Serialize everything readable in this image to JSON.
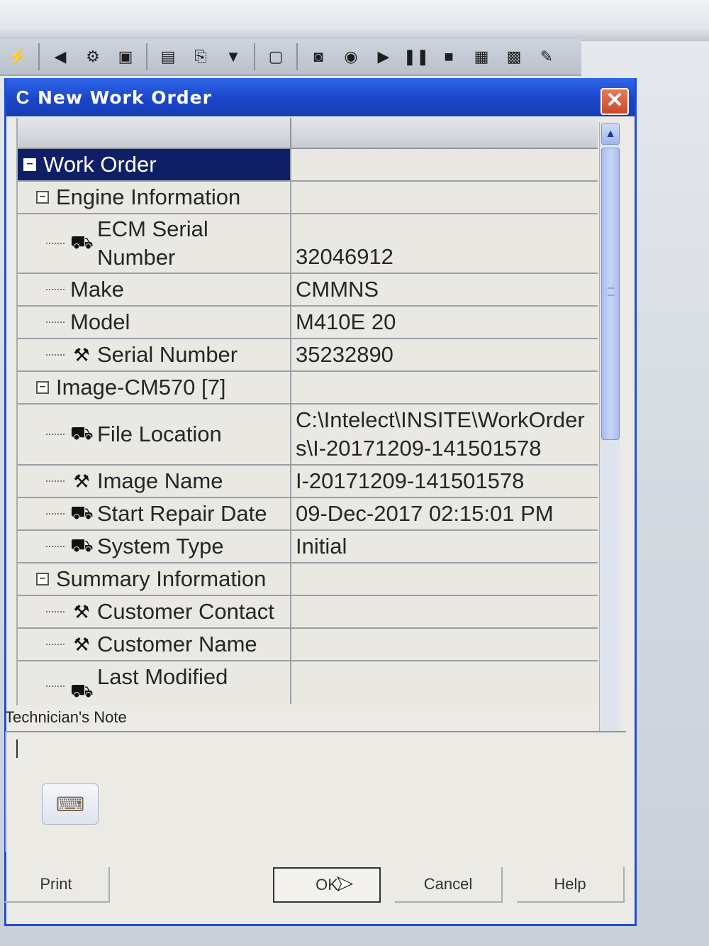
{
  "window": {
    "title": "New Work Order",
    "close_label": "✕"
  },
  "toolbar": {
    "icons": [
      "connect-icon",
      "back-icon",
      "tools-icon",
      "print-icon",
      "document-icon",
      "export-icon",
      "filter-icon",
      "page-icon",
      "camera-icon",
      "record-icon",
      "play-icon",
      "pause-icon",
      "stop-icon",
      "data-icon",
      "calculator-icon",
      "notes-icon"
    ]
  },
  "grid": {
    "rows": {
      "work_order": {
        "name": "Work Order",
        "value": ""
      },
      "engine_information": {
        "name": "Engine Information",
        "value": ""
      },
      "ecm_serial_number": {
        "name_line1": "ECM Serial",
        "name_line2": "Number",
        "value": "32046912"
      },
      "make": {
        "name": "Make",
        "value": "CMMNS"
      },
      "model": {
        "name": "Model",
        "value": "M410E 20"
      },
      "serial_number": {
        "name": "Serial Number",
        "value": "35232890"
      },
      "image_cm570": {
        "name": "Image-CM570 [7]",
        "value": ""
      },
      "file_location": {
        "name": "File Location",
        "value_line1": "C:\\Intelect\\INSITE\\WorkOrder",
        "value_line2": "s\\I-20171209-141501578"
      },
      "image_name": {
        "name": "Image Name",
        "value": "I-20171209-141501578"
      },
      "start_repair_date": {
        "name": "Start Repair Date",
        "value": "09-Dec-2017 02:15:01 PM"
      },
      "system_type": {
        "name": "System Type",
        "value": "Initial"
      },
      "summary_information": {
        "name": "Summary Information",
        "value": ""
      },
      "customer_contact": {
        "name": "Customer Contact",
        "value": ""
      },
      "customer_name": {
        "name": "Customer Name",
        "value": ""
      },
      "last_modified": {
        "name": "Last Modified",
        "value": ""
      }
    }
  },
  "note": {
    "label": "Technician's Note",
    "value": ""
  },
  "buttons": {
    "print": "Print",
    "ok": "OK",
    "cancel": "Cancel",
    "help": "Help"
  }
}
